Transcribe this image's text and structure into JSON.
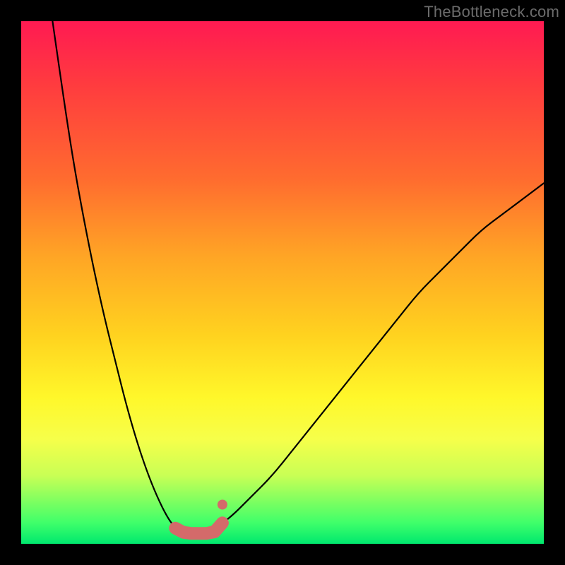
{
  "watermark": "TheBottleneck.com",
  "colors": {
    "background": "#000000",
    "frame": "#000000",
    "watermark": "#6b6b6b",
    "curve_stroke": "#000000",
    "marker_stroke": "#d46a6a",
    "marker_fill": "#d46a6a",
    "gradient_stops": [
      "#ff1a52",
      "#ff3b3f",
      "#ff6b2f",
      "#ffa525",
      "#ffd21f",
      "#fff72a",
      "#f6ff4a",
      "#c8ff55",
      "#3fff6a",
      "#00e86e"
    ]
  },
  "chart_data": {
    "type": "line",
    "title": "",
    "xlabel": "",
    "ylabel": "",
    "xlim": [
      0,
      100
    ],
    "ylim": [
      0,
      100
    ],
    "grid": false,
    "legend": false,
    "note": "Values approximate; chart has no numeric axis labels. x in [0,100] maps left→right, y in [0,100] maps bottom→top.",
    "series": [
      {
        "name": "left-curve",
        "x": [
          6,
          8,
          10,
          12,
          14,
          16,
          18,
          20,
          22,
          24,
          26,
          28,
          29.5
        ],
        "y": [
          100,
          86,
          73,
          62,
          52,
          43,
          35,
          27,
          20,
          14,
          9,
          5,
          3
        ]
      },
      {
        "name": "right-curve",
        "x": [
          38.5,
          40,
          44,
          48,
          52,
          56,
          60,
          64,
          68,
          72,
          76,
          80,
          84,
          88,
          92,
          96,
          100
        ],
        "y": [
          4,
          5,
          9,
          13,
          18,
          23,
          28,
          33,
          38,
          43,
          48,
          52,
          56,
          60,
          63,
          66,
          69
        ]
      },
      {
        "name": "bottom-markers",
        "marker_style": "round",
        "x": [
          29.5,
          31,
          32.5,
          34,
          35.5,
          37,
          38.5
        ],
        "y": [
          3,
          2.2,
          2,
          2,
          2,
          2.3,
          4
        ]
      }
    ],
    "extra_markers": [
      {
        "name": "dot-above-right-base",
        "x": 38.5,
        "y": 7.5
      }
    ]
  }
}
